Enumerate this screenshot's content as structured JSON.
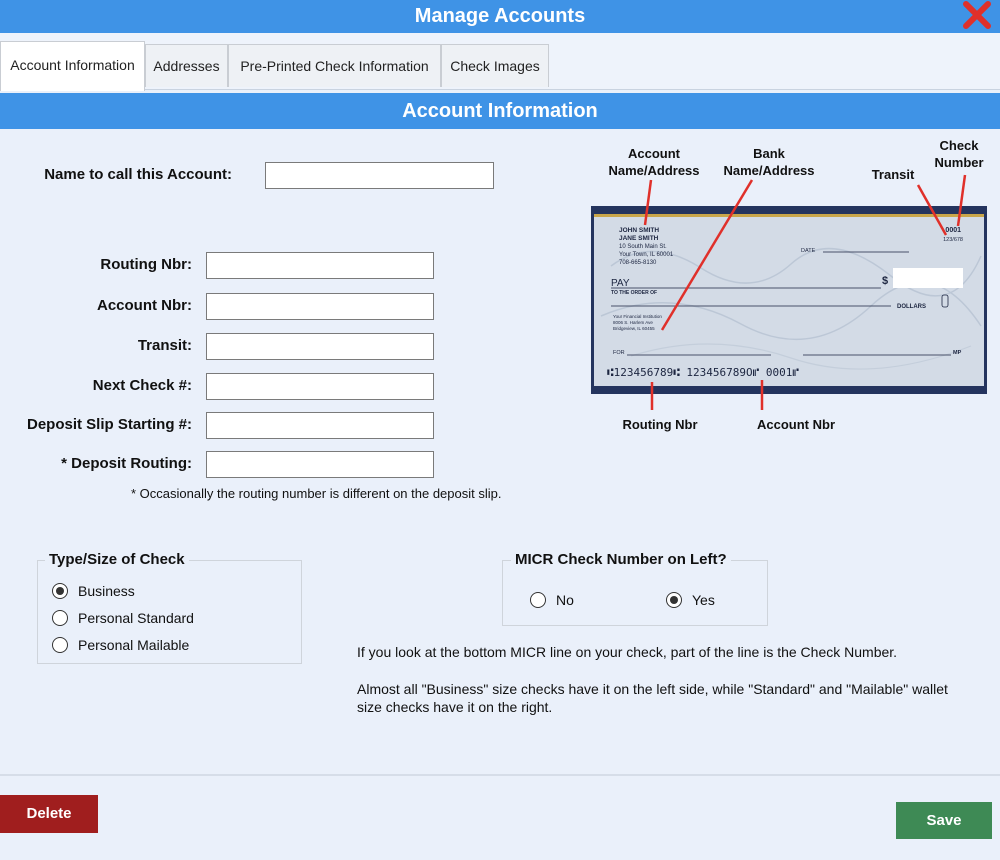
{
  "window": {
    "title": "Manage Accounts",
    "close_icon": "close-x-icon"
  },
  "tabs": [
    {
      "label": "Account Information",
      "active": true
    },
    {
      "label": "Addresses",
      "active": false
    },
    {
      "label": "Pre-Printed Check Information",
      "active": false
    },
    {
      "label": "Check Images",
      "active": false
    }
  ],
  "section": {
    "title": "Account Information"
  },
  "form": {
    "name_label": "Name to call this Account:",
    "name_value": "",
    "routing_label": "Routing Nbr:",
    "routing_value": "",
    "account_label": "Account Nbr:",
    "account_value": "",
    "transit_label": "Transit:",
    "transit_value": "",
    "next_check_label": "Next Check #:",
    "next_check_value": "",
    "deposit_slip_label": "Deposit Slip Starting #:",
    "deposit_slip_value": "",
    "deposit_routing_label": "* Deposit Routing:",
    "deposit_routing_value": "",
    "deposit_note": "* Occasionally the routing number is different on the deposit slip."
  },
  "check_diagram": {
    "labels": {
      "account_name_line1": "Account",
      "account_name_line2": "Name/Address",
      "bank_name_line1": "Bank",
      "bank_name_line2": "Name/Address",
      "transit": "Transit",
      "check_number_line1": "Check",
      "check_number_line2": "Number",
      "routing": "Routing Nbr",
      "account": "Account Nbr"
    },
    "check": {
      "owner_line1": "JOHN SMITH",
      "owner_line2": "JANE SMITH",
      "owner_line3": "10 South Main St.",
      "owner_line4": "Your Town, IL 60001",
      "owner_line5": "708-665-8130",
      "check_no": "0001",
      "transit_no": "123/678",
      "date_label": "DATE",
      "pay_label": "PAY",
      "order_label": "TO THE ORDER OF",
      "dollar_sign": "$",
      "dollars_label": "DOLLARS",
      "bank_line1": "Your Financial Institution",
      "bank_line2": "8006 S. Harlem Ave",
      "bank_line3": "Bridgeview, IL 60455",
      "for_label": "FOR",
      "mp_label": "MP",
      "micr_line": "⑆123456789⑆   123456789O⑈  0001⑈"
    }
  },
  "check_type": {
    "legend": "Type/Size of Check",
    "options": [
      {
        "label": "Business",
        "checked": true
      },
      {
        "label": "Personal Standard",
        "checked": false
      },
      {
        "label": "Personal Mailable",
        "checked": false
      }
    ]
  },
  "micr_left": {
    "legend": "MICR Check Number on Left?",
    "options": [
      {
        "label": "No",
        "checked": false
      },
      {
        "label": "Yes",
        "checked": true
      }
    ]
  },
  "info": {
    "line1": "If you look at the bottom MICR line on your check, part of the line is the Check Number.",
    "line2": "Almost all \"Business\" size checks have it on the left side, while \"Standard\"  and \"Mailable\" wallet size checks have it on the right."
  },
  "buttons": {
    "delete": "Delete",
    "save": "Save"
  },
  "colors": {
    "header_blue": "#3f93e6",
    "close_red": "#e0302a",
    "delete_red": "#a01e1e",
    "save_green": "#3e8a55",
    "check_navy": "#24345e"
  }
}
